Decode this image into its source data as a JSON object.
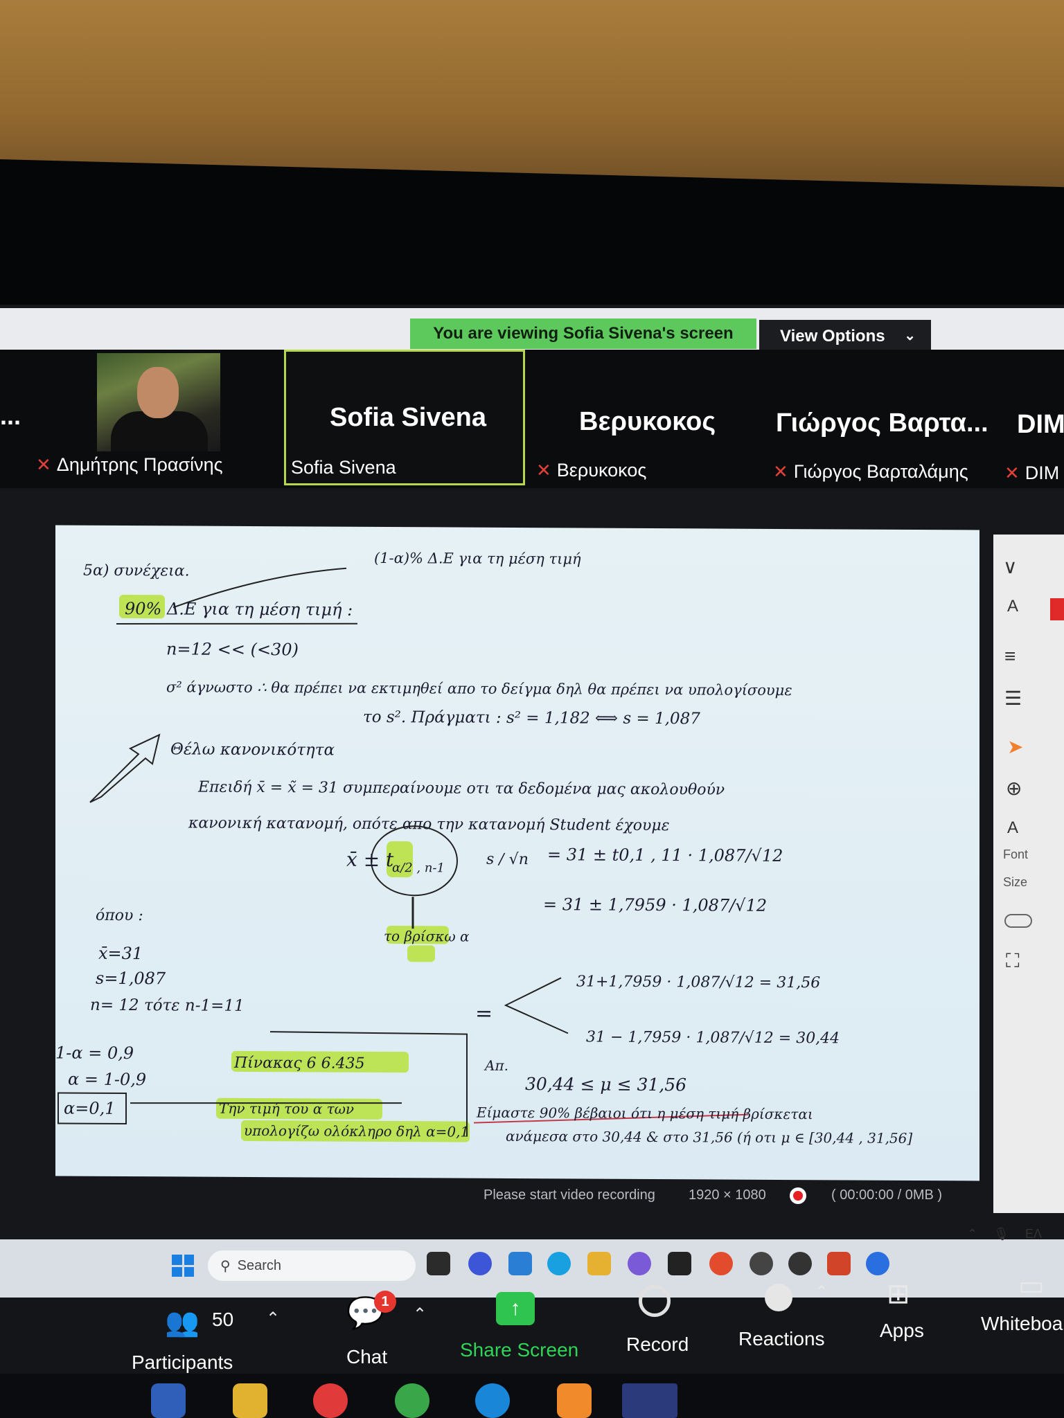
{
  "banner": {
    "viewing_text": "You are viewing Sofia Sivena's screen",
    "view_options_label": "View Options",
    "view_options_chevron": "chevron-down-icon"
  },
  "participants": [
    {
      "display": "",
      "name": "Δημήτρης Πρασίνης",
      "muted": true,
      "has_video": true
    },
    {
      "display": "Sofia Sivena",
      "name": "Sofia Sivena",
      "muted": false,
      "active": true
    },
    {
      "display": "Βερυκοκος",
      "name": "Βερυκοκος",
      "muted": true
    },
    {
      "display": "Γιώργος Βαρτα...",
      "name": "Γιώργος Βαρταλάμης",
      "muted": true
    },
    {
      "display": "DIM",
      "name": "DIM",
      "muted": true
    }
  ],
  "strip_more": "...",
  "whiteboard": {
    "header": "5α) συνέχεια.",
    "top_note": "(1-α)% Δ.Ε για τη μέση τιμή",
    "title": "90% Δ.Ε για τη μέση τιμή :",
    "bullet1": "n=12 << (<30)",
    "bullet2": "σ² άγνωστο ∴ θα πρέπει να εκτιμηθεί απο το δείγμα δηλ θα πρέπει να υπολογίσουμε",
    "bullet2b": "το s². Πράγματι : s² = 1,182 ⟺ s = 1,087",
    "bullet3": "Θέλω κανονικότητα",
    "line_a": "Επειδή x̄ = x̃ = 31 συμπεραίνουμε οτι τα δεδομένα μας ακολουθούν",
    "line_b": "κανονική κατανομή, οπότε απο την κατανομή Student έχουμε",
    "formula_lhs": "x̄ ± t",
    "formula_sub": "α/2 , n-1",
    "formula_frac": "s / √n",
    "formula_rhs1": "= 31 ± t0,1 , 11 · 1,087/√12",
    "formula_rhs2": "= 31 ± 1,7959 · 1,087/√12",
    "arrow_note": "το βρίσκω α",
    "where_label": "όπου :",
    "where_1": "x̄=31",
    "where_2": "s=1,087",
    "where_3": "n= 12 τότε n-1=11",
    "alpha_1": "1-α = 0,9",
    "alpha_2": "α = 1-0,9",
    "alpha_3": "α=0,1",
    "table_ref": "Πίνακας 6  6.435",
    "table_note_1": "Την τιμή του α των",
    "table_note_2": "υπολογίζω ολόκληρο δηλ α=0,1",
    "upper": "31+1,7959 · 1,087/√12 = 31,56",
    "lower": "31 − 1,7959 · 1,087/√12 = 30,44",
    "equals": "=",
    "answer_label": "Απ.",
    "answer": "30,44 ≤ μ ≤ 31,56",
    "conclusion_1": "Είμαστε 90% βέβαιοι ότι η μέση τιμή βρίσκεται",
    "conclusion_2": "ανάμεσα στο 30,44 & στο 31,56 (ή οτι μ ∈ [30,44 , 31,56]"
  },
  "annotation_toolbar": {
    "font_label": "Font",
    "size_label": "Size"
  },
  "recording": {
    "prompt": "Please start video recording",
    "resolution": "1920 × 1080",
    "time": "( 00:00:00 / 0MB )"
  },
  "windows_taskbar": {
    "search_placeholder": "Search",
    "lang": "ΕΛ"
  },
  "controls": {
    "participants_count": "50",
    "participants_label": "Participants",
    "chat_label": "Chat",
    "chat_badge": "1",
    "share_label": "Share Screen",
    "record_label": "Record",
    "reactions_label": "Reactions",
    "apps_label": "Apps",
    "whiteboard_label": "Whiteboar"
  },
  "colors": {
    "banner_green": "#5dc95d",
    "share_green": "#2fc450",
    "active_border": "#b6d94c",
    "mute_red": "#e0403a",
    "highlighter": "#b7e23a"
  }
}
